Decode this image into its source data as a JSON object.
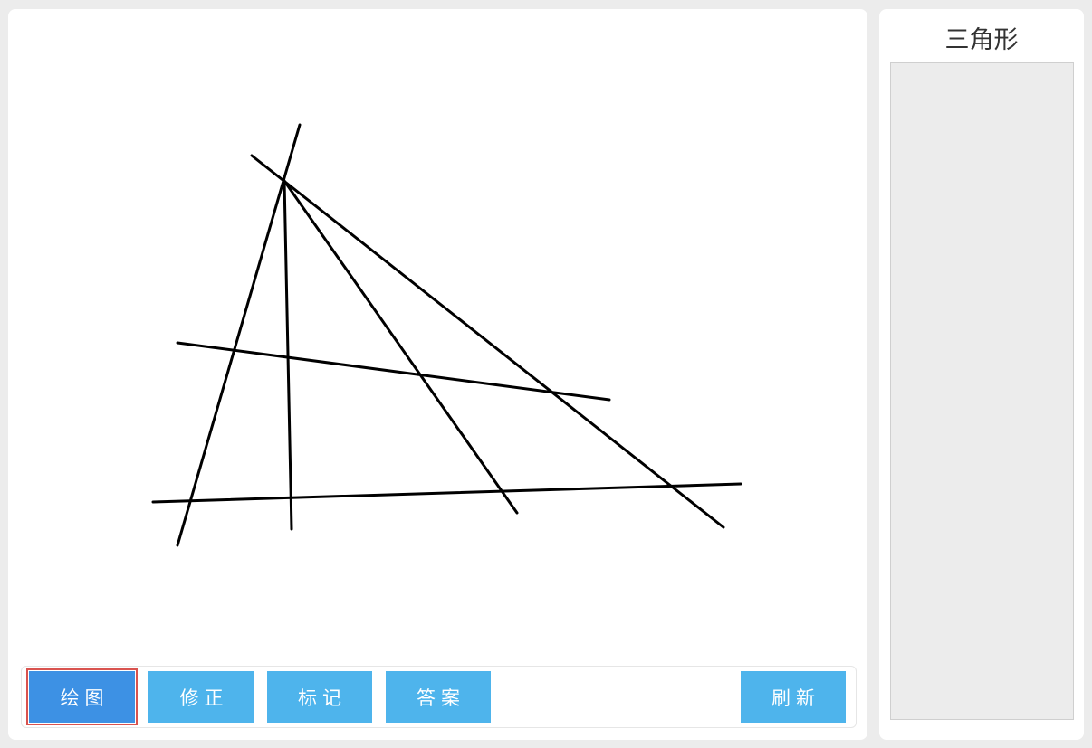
{
  "sidebar": {
    "title": "三角形"
  },
  "toolbar": {
    "buttons": [
      {
        "label": "绘图",
        "active": true
      },
      {
        "label": "修正",
        "active": false
      },
      {
        "label": "标记",
        "active": false
      },
      {
        "label": "答案",
        "active": false
      },
      {
        "label": "刷新",
        "active": false
      }
    ]
  },
  "drawing": {
    "line_count": 6,
    "stroke_color": "#000000"
  },
  "colors": {
    "button": "#4eb4ec",
    "button_active": "#3d91e4",
    "active_outline": "#d9534f",
    "panel_bg": "#ffffff",
    "page_bg": "#ececec"
  }
}
